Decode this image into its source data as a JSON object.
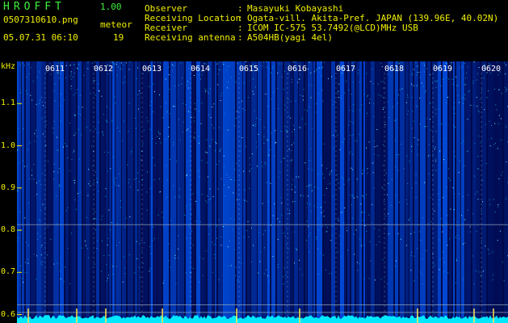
{
  "app": {
    "title": "HROFFT",
    "version": "1.00"
  },
  "file": {
    "name": "0507310610.png",
    "timestamp": "05.07.31 06:10"
  },
  "meteor": {
    "label": "meteor",
    "count": "19"
  },
  "station": [
    {
      "key": "Observer",
      "value": "Masayuki Kobayashi"
    },
    {
      "key": "Receiving Location",
      "value": "Ogata-vill. Akita-Pref. JAPAN (139.96E, 40.02N)"
    },
    {
      "key": "Receiver",
      "value": "ICOM IC-575 53.7492(@LCD)MHz USB"
    },
    {
      "key": "Receiving antenna",
      "value": "A504HB(yagi 4el)"
    }
  ],
  "spectrogram": {
    "y_unit": "kHz",
    "y_ticks": [
      "1.1",
      "1.0",
      "0.9",
      "0.8",
      "0.7",
      "0.6"
    ],
    "y_tick_values": [
      1.1,
      1.0,
      0.9,
      0.8,
      0.7,
      0.6
    ],
    "y_range": [
      0.58,
      1.2
    ],
    "time_ticks": [
      "0611",
      "0612",
      "0613",
      "0614",
      "0615",
      "0616",
      "0617",
      "0618",
      "0619",
      "0620"
    ],
    "time_range_minutes": [
      0,
      10
    ],
    "background_color": "#000a4a",
    "label_color": "#f0f000",
    "title_color": "#3cf23c",
    "signal_color": "#00e8ff"
  }
}
